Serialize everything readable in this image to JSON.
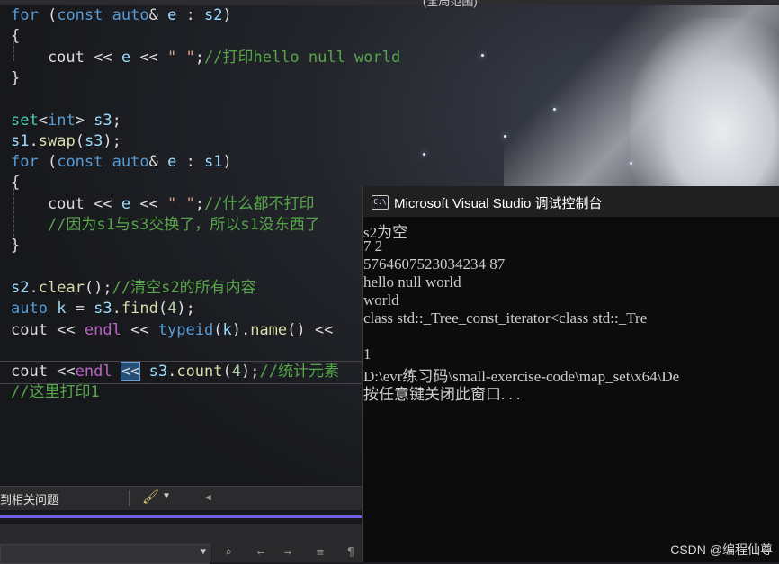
{
  "window": {
    "top_title_fragment": "(全局范围)"
  },
  "editor": {
    "lines": [
      {
        "segments": [
          [
            "kw",
            "for"
          ],
          [
            "p",
            " ("
          ],
          [
            "kw",
            "const"
          ],
          [
            "p",
            " "
          ],
          [
            "kw",
            "auto"
          ],
          [
            "p",
            "& "
          ],
          [
            "var",
            "e"
          ],
          [
            "p",
            " : "
          ],
          [
            "var",
            "s2"
          ],
          [
            "p",
            ")"
          ]
        ]
      },
      {
        "segments": [
          [
            "p",
            "{"
          ]
        ]
      },
      {
        "segments": [
          [
            "p",
            "    cout << "
          ],
          [
            "var",
            "e"
          ],
          [
            "p",
            " << "
          ],
          [
            "str",
            "\" \""
          ],
          [
            "p",
            ";"
          ],
          [
            "cmt",
            "//打印hello null world"
          ]
        ]
      },
      {
        "segments": [
          [
            "p",
            "}"
          ]
        ]
      },
      {
        "segments": []
      },
      {
        "segments": [
          [
            "type",
            "set"
          ],
          [
            "p",
            "<"
          ],
          [
            "kw",
            "int"
          ],
          [
            "p",
            "> "
          ],
          [
            "var",
            "s3"
          ],
          [
            "p",
            ";"
          ]
        ]
      },
      {
        "segments": [
          [
            "var",
            "s1"
          ],
          [
            "p",
            "."
          ],
          [
            "fn",
            "swap"
          ],
          [
            "p",
            "("
          ],
          [
            "var",
            "s3"
          ],
          [
            "p",
            ");"
          ]
        ]
      },
      {
        "segments": [
          [
            "kw",
            "for"
          ],
          [
            "p",
            " ("
          ],
          [
            "kw",
            "const"
          ],
          [
            "p",
            " "
          ],
          [
            "kw",
            "auto"
          ],
          [
            "p",
            "& "
          ],
          [
            "var",
            "e"
          ],
          [
            "p",
            " : "
          ],
          [
            "var",
            "s1"
          ],
          [
            "p",
            ")"
          ]
        ]
      },
      {
        "segments": [
          [
            "p",
            "{"
          ]
        ]
      },
      {
        "segments": [
          [
            "p",
            "    cout << "
          ],
          [
            "var",
            "e"
          ],
          [
            "p",
            " << "
          ],
          [
            "str",
            "\" \""
          ],
          [
            "p",
            ";"
          ],
          [
            "cmt",
            "//什么都不打印"
          ]
        ]
      },
      {
        "segments": [
          [
            "p",
            "    "
          ],
          [
            "cmt",
            "//因为s1与s3交换了，所以s1没东西了"
          ]
        ]
      },
      {
        "segments": [
          [
            "p",
            "}"
          ]
        ]
      },
      {
        "segments": []
      },
      {
        "segments": [
          [
            "var",
            "s2"
          ],
          [
            "p",
            "."
          ],
          [
            "fn",
            "clear"
          ],
          [
            "p",
            "();"
          ],
          [
            "cmt",
            "//清空s2的所有内容"
          ]
        ]
      },
      {
        "segments": [
          [
            "kw",
            "auto"
          ],
          [
            "p",
            " "
          ],
          [
            "var",
            "k"
          ],
          [
            "p",
            " = "
          ],
          [
            "var",
            "s3"
          ],
          [
            "p",
            "."
          ],
          [
            "fn",
            "find"
          ],
          [
            "p",
            "("
          ],
          [
            "num",
            "4"
          ],
          [
            "p",
            ");"
          ]
        ]
      },
      {
        "segments": [
          [
            "p",
            "cout << "
          ],
          [
            "macro",
            "endl"
          ],
          [
            "p",
            " << "
          ],
          [
            "kw",
            "typeid"
          ],
          [
            "p",
            "("
          ],
          [
            "var",
            "k"
          ],
          [
            "p",
            ")."
          ],
          [
            "fn",
            "name"
          ],
          [
            "p",
            "() <<"
          ]
        ]
      },
      {
        "segments": []
      },
      {
        "segments": [
          [
            "p",
            "cout <<"
          ],
          [
            "macro",
            "endl"
          ],
          [
            "p",
            " "
          ],
          [
            "sel",
            "<<"
          ],
          [
            "p",
            " "
          ],
          [
            "var",
            "s3"
          ],
          [
            "p",
            "."
          ],
          [
            "fn",
            "count"
          ],
          [
            "p",
            "("
          ],
          [
            "num",
            "4"
          ],
          [
            "p",
            ");"
          ],
          [
            "cmt",
            "//统计元素"
          ]
        ]
      },
      {
        "segments": [
          [
            "cmt",
            "//这里打印1"
          ]
        ]
      }
    ]
  },
  "status": {
    "label": "到相关问题"
  },
  "console": {
    "title": "Microsoft Visual Studio 调试控制台",
    "icon_text": "C:\\",
    "lines": [
      "s2为空",
      "7 2",
      "5764607523034234 87",
      "hello null world",
      "world",
      "class std::_Tree_const_iterator<class std::_Tre",
      "",
      "1",
      "D:\\evr练习码\\small-exercise-code\\map_set\\x64\\De",
      "按任意键关闭此窗口. . ."
    ]
  },
  "watermark": "CSDN @编程仙尊",
  "colors": {
    "keyword": "#569cd6",
    "type": "#4ec9b0",
    "function": "#dcdcaa",
    "variable": "#9cdcfe",
    "string": "#d69d85",
    "comment": "#57a64a",
    "accent_bar": "#7160e8"
  },
  "icons": [
    "console-app-icon",
    "brush-icon",
    "chevron-down-icon",
    "left-arrow-icon"
  ]
}
